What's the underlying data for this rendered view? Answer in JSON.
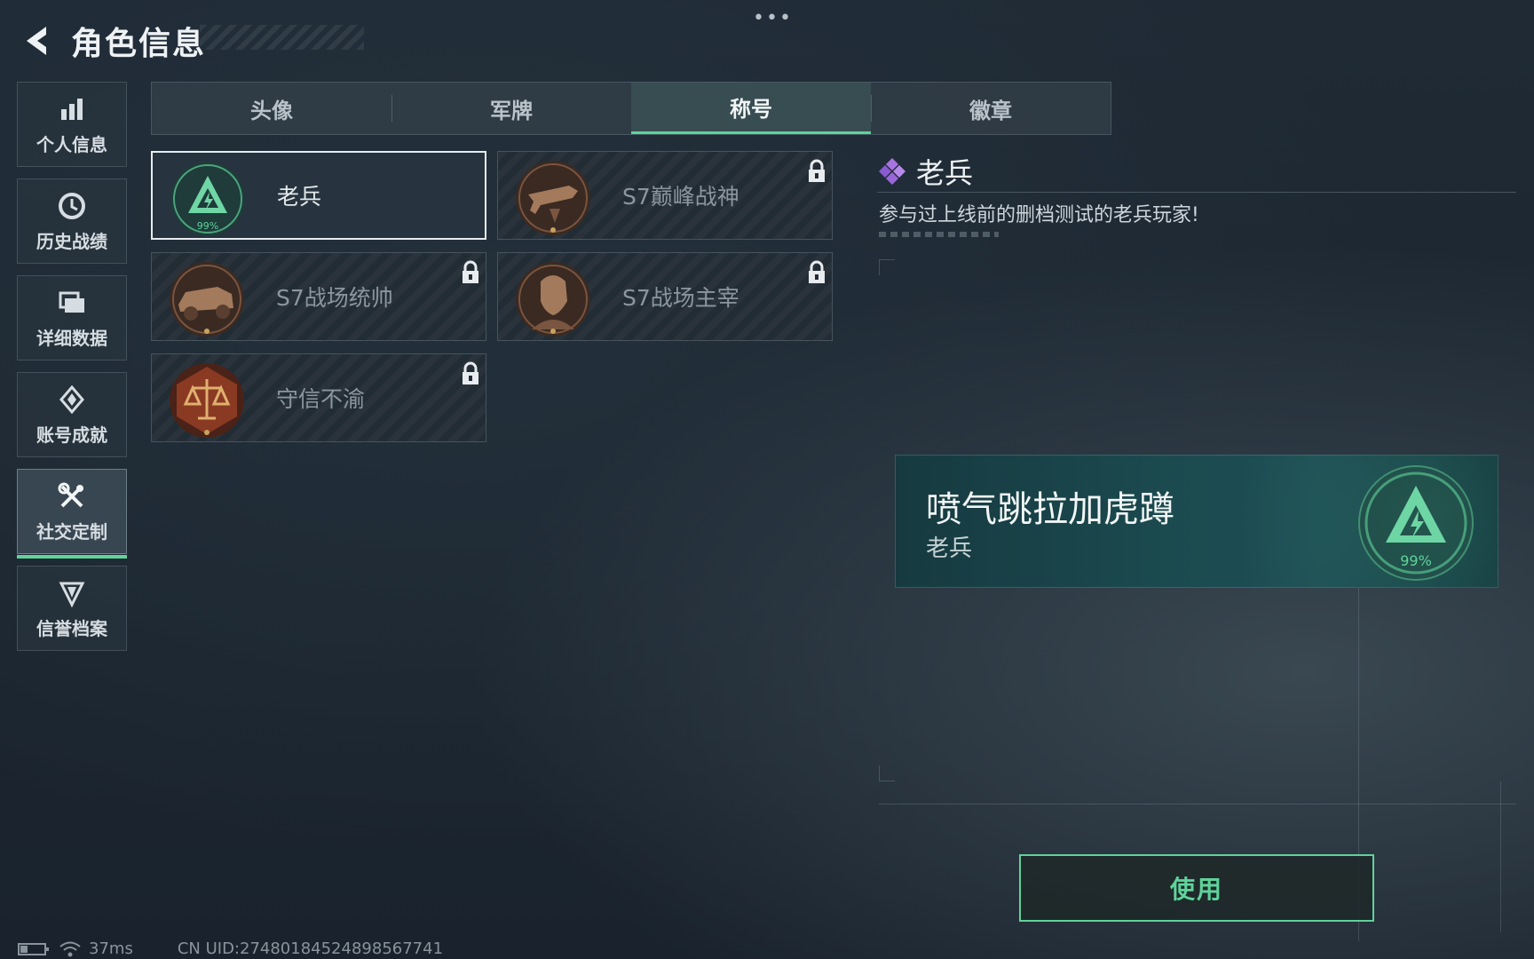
{
  "header": {
    "title": "角色信息",
    "dots": "•••"
  },
  "sidebar": {
    "items": [
      {
        "label": "个人信息",
        "icon": "bar-chart-icon"
      },
      {
        "label": "历史战绩",
        "icon": "history-icon"
      },
      {
        "label": "详细数据",
        "icon": "folder-icon"
      },
      {
        "label": "账号成就",
        "icon": "achievement-icon"
      },
      {
        "label": "社交定制",
        "icon": "tools-icon",
        "active": true
      },
      {
        "label": "信誉档案",
        "icon": "reputation-icon"
      }
    ]
  },
  "tabs": [
    {
      "label": "头像"
    },
    {
      "label": "军牌"
    },
    {
      "label": "称号",
      "active": true
    },
    {
      "label": "徽章"
    }
  ],
  "titles": [
    {
      "label": "老兵",
      "selected": true,
      "locked": false,
      "icon": "veteran-badge-icon",
      "badge_text": "99%"
    },
    {
      "label": "S7巅峰战神",
      "selected": false,
      "locked": true,
      "icon": "weapon-badge-icon"
    },
    {
      "label": "S7战场统帅",
      "selected": false,
      "locked": true,
      "icon": "vehicle-badge-icon"
    },
    {
      "label": "S7战场主宰",
      "selected": false,
      "locked": true,
      "icon": "soldier-badge-icon"
    },
    {
      "label": "守信不渝",
      "selected": false,
      "locked": true,
      "icon": "scales-badge-icon"
    }
  ],
  "detail": {
    "name": "老兵",
    "description": "参与过上线前的删档测试的老兵玩家!",
    "icon": "purple-diamond-icon"
  },
  "nameplate": {
    "player_name": "喷气跳拉加虎蹲",
    "title": "老兵",
    "badge_text": "99%"
  },
  "use_button": {
    "label": "使用"
  },
  "footer": {
    "ping": "37ms",
    "uid": "CN UID:27480184524898567741"
  },
  "colors": {
    "accent": "#5fd39a",
    "background": "#1c2530",
    "plate": "#1b4a4f"
  }
}
